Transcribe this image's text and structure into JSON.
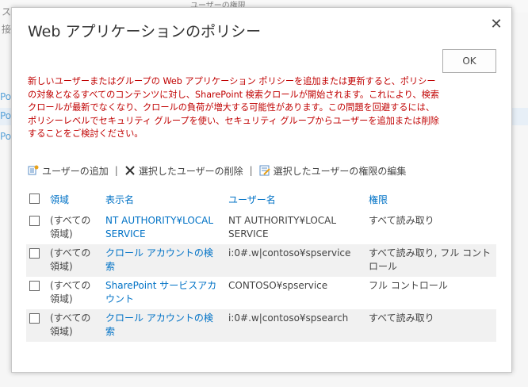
{
  "dialog": {
    "title": "Web アプリケーションのポリシー",
    "ok_label": "OK",
    "close_glyph": "✕",
    "warning": "新しいユーザーまたはグループの Web アプリケーション ポリシーを追加または更新すると、ポリシーの対象となるすべてのコンテンツに対し、SharePoint 検索クロールが開始されます。これにより、検索クロールが最新でなくなり、クロールの負荷が増大する可能性があります。この問題を回避するには、ポリシーレベルでセキュリティ グループを使い、セキュリティ グループからユーザーを追加または削除することをご検討ください。"
  },
  "toolbar": {
    "add_users": "ユーザーの追加",
    "delete_selected": "選択したユーザーの削除",
    "edit_permissions": "選択したユーザーの権限の編集",
    "separator": "|"
  },
  "table": {
    "headers": {
      "zone": "領域",
      "display_name": "表示名",
      "user_name": "ユーザー名",
      "permissions": "権限"
    },
    "rows": [
      {
        "zone": "(すべての領域)",
        "display_name": "NT AUTHORITY¥LOCAL SERVICE",
        "user_name": "NT AUTHORITY¥LOCAL SERVICE",
        "permissions": "すべて読み取り"
      },
      {
        "zone": "(すべての領域)",
        "display_name": "クロール アカウントの検索",
        "user_name": "i:0#.w|contoso¥spservice",
        "permissions": "すべて読み取り, フル コントロール"
      },
      {
        "zone": "(すべての領域)",
        "display_name": "SharePoint サービスアカウント",
        "user_name": "CONTOSO¥spservice",
        "permissions": "フル コントロール"
      },
      {
        "zone": "(すべての領域)",
        "display_name": "クロール アカウントの検索",
        "user_name": "i:0#.w|contoso¥spsearch",
        "permissions": "すべて読み取り"
      }
    ]
  },
  "background": {
    "left_1": "ス",
    "left_2": "接",
    "ribbon_text": "ユーザーの権限",
    "po_1": "Po",
    "po_2": "Po",
    "po_3": "Po"
  },
  "colors": {
    "link": "#0072c6",
    "warning": "#c00000"
  }
}
